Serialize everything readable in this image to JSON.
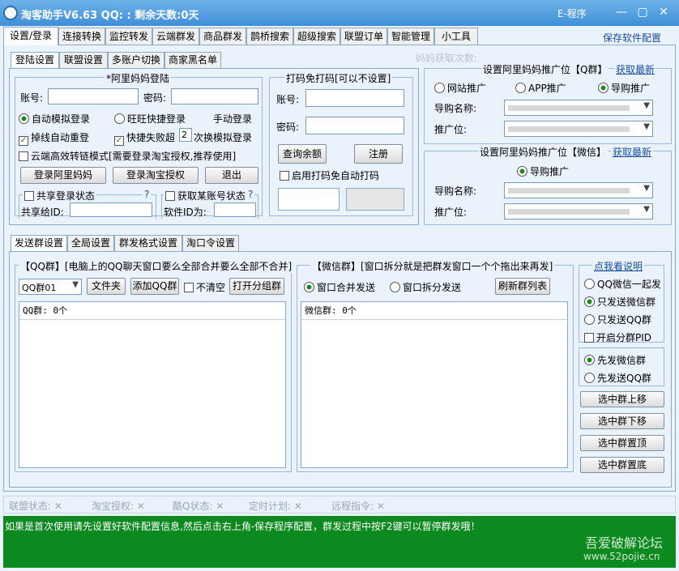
{
  "window": {
    "title": "淘客助手V6.63 QQ:     : 剩余天数:0天",
    "menu": "E-程序",
    "min": "—",
    "restore": "▢",
    "close": "✕"
  },
  "main_tabs": [
    "设置/登录",
    "连接转换",
    "监控转发",
    "云端群发",
    "商品群发",
    "鹊桥搜索",
    "超级搜索",
    "联盟订单",
    "智能管理",
    "小工具"
  ],
  "save_config": "保存软件配置",
  "login_tabs": [
    "登陆设置",
    "联盟设置",
    "多账户切换",
    "商家黑名单"
  ],
  "mama_balance": "妈妈获取次数:",
  "login": {
    "group_title": "*阿里妈妈登陆",
    "account_label": "账号:",
    "password_label": "密码:",
    "auto_login": "自动模拟登录",
    "wangwang_login": "旺旺快捷登录",
    "manual_login": "手动登录",
    "drop_relogin": "掉线自动重登",
    "fast_fail": "快捷失败超",
    "fast_fail_value": "2",
    "fast_fail_suffix": "次换模拟登录",
    "cloud_mode": "云端高效转链模式[需要登录淘宝授权,推荐使用]",
    "btn_login_mama": "登录阿里妈妈",
    "btn_login_taobao": "登录淘宝授权",
    "btn_exit": "退出",
    "share_title": "共享登录状态",
    "share_label": "共享给ID:",
    "get_title": "获取某账号状态",
    "get_label": "软件ID为:",
    "q": "?"
  },
  "captcha": {
    "title": "打码免打码[可以不设置]",
    "account_label": "账号:",
    "password_label": "密码:",
    "btn_query": "查询余额",
    "btn_register": "注册",
    "auto_label": "启用打码免自动打码"
  },
  "qq_promo": {
    "title": "设置阿里妈妈推广位【Q群】",
    "link": "获取最新",
    "r1": "网站推广",
    "r2": "APP推广",
    "r3": "导购推广",
    "name_label": "导购名称:",
    "pos_label": "推广位:"
  },
  "wx_promo": {
    "title": "设置阿里妈妈推广位【微信】",
    "link": "获取最新",
    "r1": "导购推广",
    "name_label": "导购名称:",
    "pos_label": "推广位:"
  },
  "send_tabs": [
    "发送群设置",
    "全局设置",
    "群发格式设置",
    "淘口令设置"
  ],
  "qq_group": {
    "title": "【QQ群】[电脑上的QQ聊天窗口要么全部合并要么全部不合并]",
    "select": "QQ群01",
    "btn_folder": "文件夹",
    "btn_add": "添加QQ群",
    "no_clear": "不清空",
    "btn_open": "打开分组群",
    "list_header": "QQ群: 0个"
  },
  "wx_group": {
    "title": "【微信群】[窗口拆分就是把群发窗口一个个拖出来再发]",
    "r1": "窗口合并发送",
    "r2": "窗口拆分发送",
    "btn_refresh": "刷新群列表",
    "list_header": "微信群: 0个"
  },
  "send_opts": {
    "link": "点我看说明",
    "o1": "QQ微信一起发",
    "o2": "只发送微信群",
    "o3": "只发送QQ群",
    "pid": "开启分群PID",
    "o4": "先发微信群",
    "o5": "先发送QQ群",
    "b1": "选中群上移",
    "b2": "选中群下移",
    "b3": "选中群置顶",
    "b4": "选中群置底"
  },
  "status": [
    "联盟状态: ✕",
    "淘宝授权: ✕",
    "酷Q状态: ✕",
    "定时计划: ✕",
    "远程指令: ✕"
  ],
  "info": "如果是首次使用请先设置好软件配置信息,然后点击右上角-保存程序配置，群发过程中按F2键可以暂停群发哦！",
  "watermark": {
    "line1": "吾爱破解论坛",
    "line2": "www.52pojie.cn"
  }
}
